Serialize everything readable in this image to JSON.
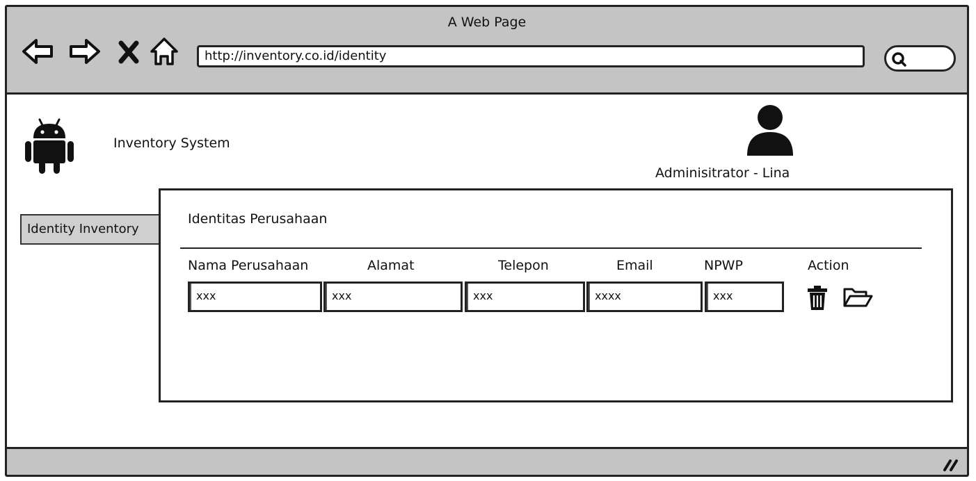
{
  "browser": {
    "window_title": "A Web Page",
    "url": "http://inventory.co.id/identity",
    "nav_icons": [
      "back-arrow-icon",
      "forward-arrow-icon",
      "close-icon",
      "home-icon"
    ],
    "search_icon": "search-icon"
  },
  "header": {
    "logo_icon": "android-icon",
    "app_title": "Inventory System",
    "avatar_icon": "user-icon",
    "user_label": "Adminisitrator - Lina"
  },
  "sidebar": {
    "items": [
      {
        "label": "Identity Inventory"
      }
    ]
  },
  "panel": {
    "title": "Identitas Perusahaan",
    "columns": [
      "Nama Perusahaan",
      "Alamat",
      "Telepon",
      "Email",
      "NPWP",
      "Action"
    ],
    "rows": [
      {
        "nama": "xxx",
        "alamat": "xxx",
        "telepon": "xxx",
        "email": "xxxx",
        "npwp": "xxx",
        "actions": [
          "trash-icon",
          "folder-open-icon"
        ]
      }
    ]
  },
  "colors": {
    "chrome": "#c4c4c4",
    "tab": "#cfcfcf",
    "stroke": "#222222"
  }
}
